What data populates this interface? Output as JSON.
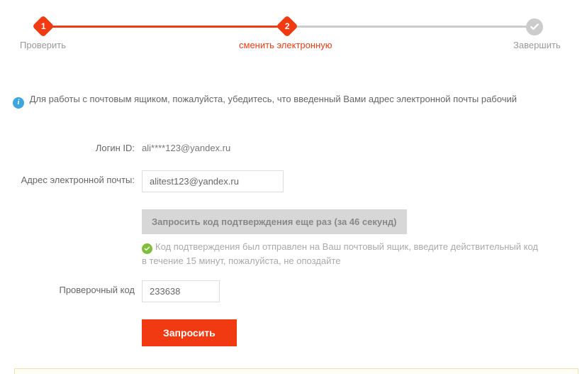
{
  "steps": {
    "s1": {
      "num": "1",
      "label": "Проверить"
    },
    "s2": {
      "num": "2",
      "label": "сменить электронную"
    },
    "s3": {
      "label": "Завершить"
    }
  },
  "notice": {
    "text": "Для работы с почтовым ящиком, пожалуйста, убедитесь, что введенный Вами адрес электронной почты рабочий"
  },
  "form": {
    "login_label": "Логин ID:",
    "login_value": "ali****123@yandex.ru",
    "email_label": "Адрес электронной почты:",
    "email_value": "alitest123@yandex.ru",
    "resend_button": "Запросить код подтверждения еще раз (за 46 секунд)",
    "sent_message": "Код подтверждения был отправлен на Ваш почтовый ящик, введите действительный код в течение 15 минут, пожалуйста, не опоздайте",
    "code_label": "Проверочный код",
    "code_value": "233638",
    "submit_label": "Запросить"
  },
  "colors": {
    "accent": "#f13a12",
    "muted": "#ccc",
    "info": "#3ca6e0",
    "success": "#7fbf3a"
  }
}
